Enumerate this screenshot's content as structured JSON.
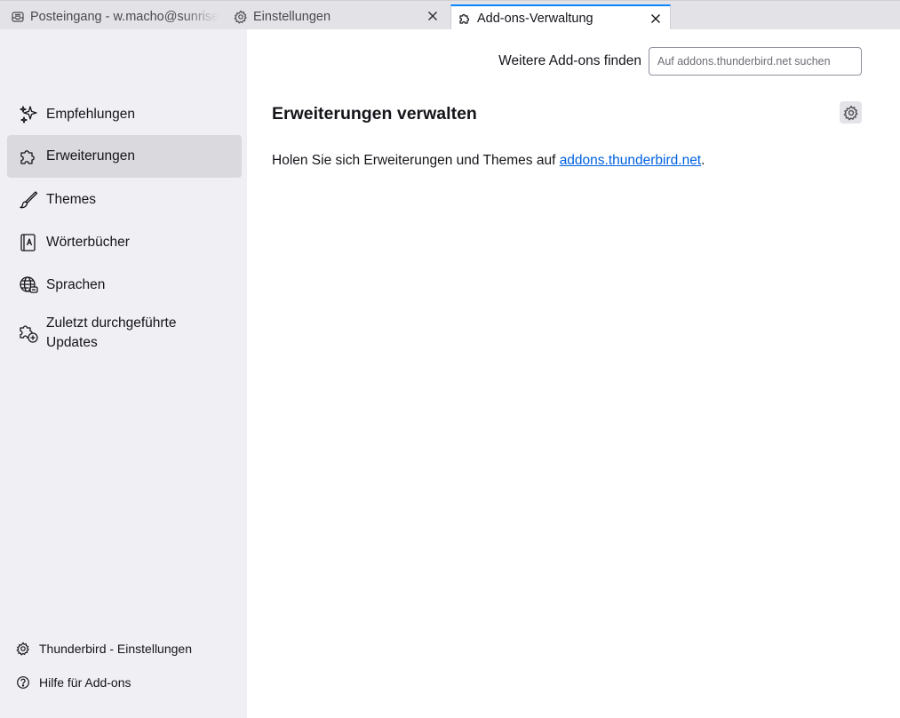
{
  "tabs": [
    {
      "label": "Posteingang - w.macho@sunrise",
      "icon": "inbox-icon"
    },
    {
      "label": "Einstellungen",
      "icon": "gear-icon",
      "close": "close-icon"
    },
    {
      "label": "Add-ons-Verwaltung",
      "icon": "puzzle-icon",
      "close": "close-icon",
      "active": true
    }
  ],
  "sidebar": {
    "items": [
      {
        "label": "Empfehlungen",
        "icon": "sparkles-icon"
      },
      {
        "label": "Erweiterungen",
        "icon": "puzzle-icon",
        "active": true
      },
      {
        "label": "Themes",
        "icon": "brush-icon"
      },
      {
        "label": "Wörterbücher",
        "icon": "dictionary-icon"
      },
      {
        "label": "Sprachen",
        "icon": "globe-icon"
      },
      {
        "label": "Zuletzt durchgeführte Updates",
        "icon": "puzzle-update-icon"
      }
    ],
    "footer": [
      {
        "label": "Thunderbird - Einstellungen",
        "icon": "gear-icon"
      },
      {
        "label": "Hilfe für Add-ons",
        "icon": "help-icon"
      }
    ]
  },
  "main": {
    "find_label": "Weitere Add-ons finden",
    "search_placeholder": "Auf addons.thunderbird.net suchen",
    "title": "Erweiterungen verwalten",
    "info_prefix": "Holen Sie sich Erweiterungen und Themes auf ",
    "info_link": "addons.thunderbird.net",
    "info_suffix": "."
  },
  "colors": {
    "accent": "#0a84ff",
    "link": "#0061e0",
    "sidebar_bg": "#f0f0f4",
    "active_item_bg": "#dadade"
  }
}
